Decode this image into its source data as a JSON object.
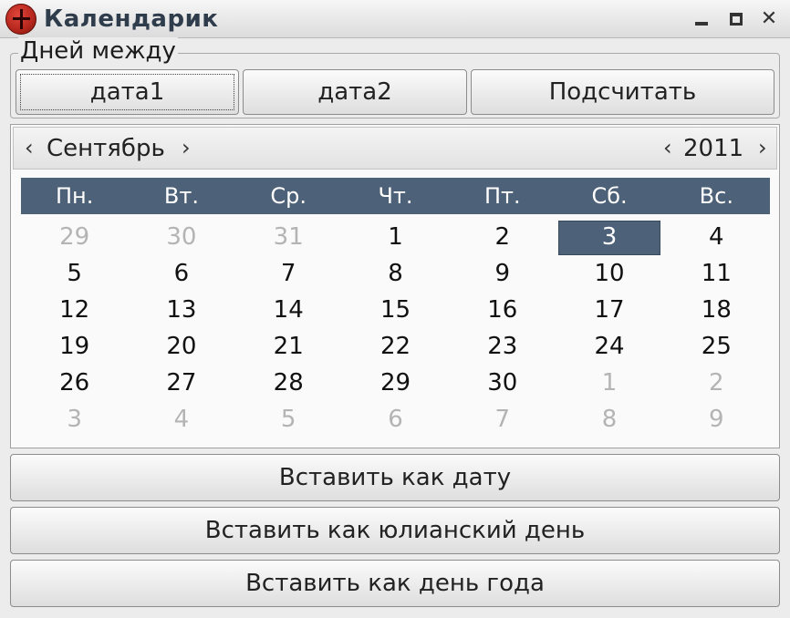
{
  "window": {
    "title": "Календарик",
    "controls": {
      "minimize_icon": "minimize-icon",
      "maximize_icon": "maximize-icon",
      "close_icon": "close-icon",
      "close_glyph": "✕"
    }
  },
  "days_between": {
    "label": "Дней между",
    "date1_label": "дата1",
    "date2_label": "дата2",
    "calculate_label": "Подсчитать"
  },
  "calendar": {
    "prev_month_glyph": "‹",
    "next_month_glyph": "›",
    "prev_year_glyph": "‹",
    "next_year_glyph": "›",
    "month": "Сентябрь",
    "year": "2011",
    "weekdays": [
      "Пн.",
      "Вт.",
      "Ср.",
      "Чт.",
      "Пт.",
      "Сб.",
      "Вс."
    ],
    "weeks": [
      [
        {
          "d": "29",
          "o": true
        },
        {
          "d": "30",
          "o": true
        },
        {
          "d": "31",
          "o": true
        },
        {
          "d": "1"
        },
        {
          "d": "2"
        },
        {
          "d": "3",
          "sel": true
        },
        {
          "d": "4"
        }
      ],
      [
        {
          "d": "5"
        },
        {
          "d": "6"
        },
        {
          "d": "7"
        },
        {
          "d": "8"
        },
        {
          "d": "9"
        },
        {
          "d": "10"
        },
        {
          "d": "11"
        }
      ],
      [
        {
          "d": "12"
        },
        {
          "d": "13"
        },
        {
          "d": "14"
        },
        {
          "d": "15"
        },
        {
          "d": "16"
        },
        {
          "d": "17"
        },
        {
          "d": "18"
        }
      ],
      [
        {
          "d": "19"
        },
        {
          "d": "20"
        },
        {
          "d": "21"
        },
        {
          "d": "22"
        },
        {
          "d": "23"
        },
        {
          "d": "24"
        },
        {
          "d": "25"
        }
      ],
      [
        {
          "d": "26"
        },
        {
          "d": "27"
        },
        {
          "d": "28"
        },
        {
          "d": "29"
        },
        {
          "d": "30"
        },
        {
          "d": "1",
          "o": true
        },
        {
          "d": "2",
          "o": true
        }
      ],
      [
        {
          "d": "3",
          "o": true
        },
        {
          "d": "4",
          "o": true
        },
        {
          "d": "5",
          "o": true
        },
        {
          "d": "6",
          "o": true
        },
        {
          "d": "7",
          "o": true
        },
        {
          "d": "8",
          "o": true
        },
        {
          "d": "9",
          "o": true
        }
      ]
    ],
    "colors": {
      "header": "#4d6178",
      "selected": "#4d6178",
      "other_month": "#b4b4b4"
    }
  },
  "actions": {
    "insert_as_date": "Вставить как дату",
    "insert_as_julian_day": "Вставить как юлианский день",
    "insert_as_day_of_year": "Вставить как день года"
  }
}
